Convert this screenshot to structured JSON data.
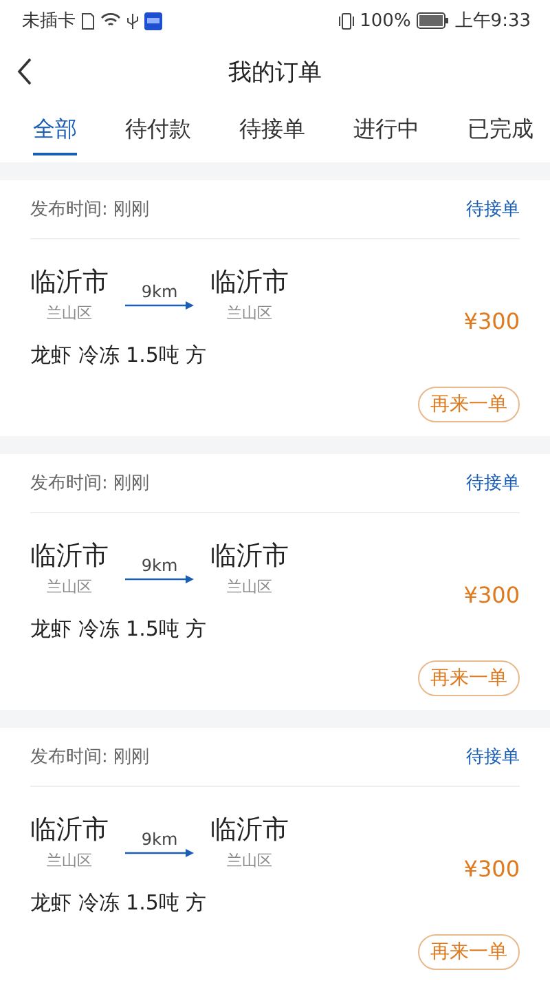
{
  "status_bar": {
    "carrier": "未插卡",
    "battery": "100%",
    "time": "上午9:33"
  },
  "header": {
    "title": "我的订单"
  },
  "tabs": [
    {
      "label": "全部",
      "selected": true
    },
    {
      "label": "待付款",
      "selected": false
    },
    {
      "label": "待接单",
      "selected": false
    },
    {
      "label": "进行中",
      "selected": false
    },
    {
      "label": "已完成",
      "selected": false
    }
  ],
  "orders": [
    {
      "time_label": "发布时间:",
      "time": "刚刚",
      "status": "待接单",
      "from_city": "临沂市",
      "from_district": "兰山区",
      "distance": "9km",
      "to_city": "临沂市",
      "to_district": "兰山区",
      "price": "¥300",
      "goods": "龙虾 冷冻 1.5吨 方",
      "action": "再来一单"
    },
    {
      "time_label": "发布时间:",
      "time": "刚刚",
      "status": "待接单",
      "from_city": "临沂市",
      "from_district": "兰山区",
      "distance": "9km",
      "to_city": "临沂市",
      "to_district": "兰山区",
      "price": "¥300",
      "goods": "龙虾 冷冻 1.5吨 方",
      "action": "再来一单"
    },
    {
      "time_label": "发布时间:",
      "time": "刚刚",
      "status": "待接单",
      "from_city": "临沂市",
      "from_district": "兰山区",
      "distance": "9km",
      "to_city": "临沂市",
      "to_district": "兰山区",
      "price": "¥300",
      "goods": "龙虾 冷冻 1.5吨 方",
      "action": "再来一单"
    }
  ]
}
